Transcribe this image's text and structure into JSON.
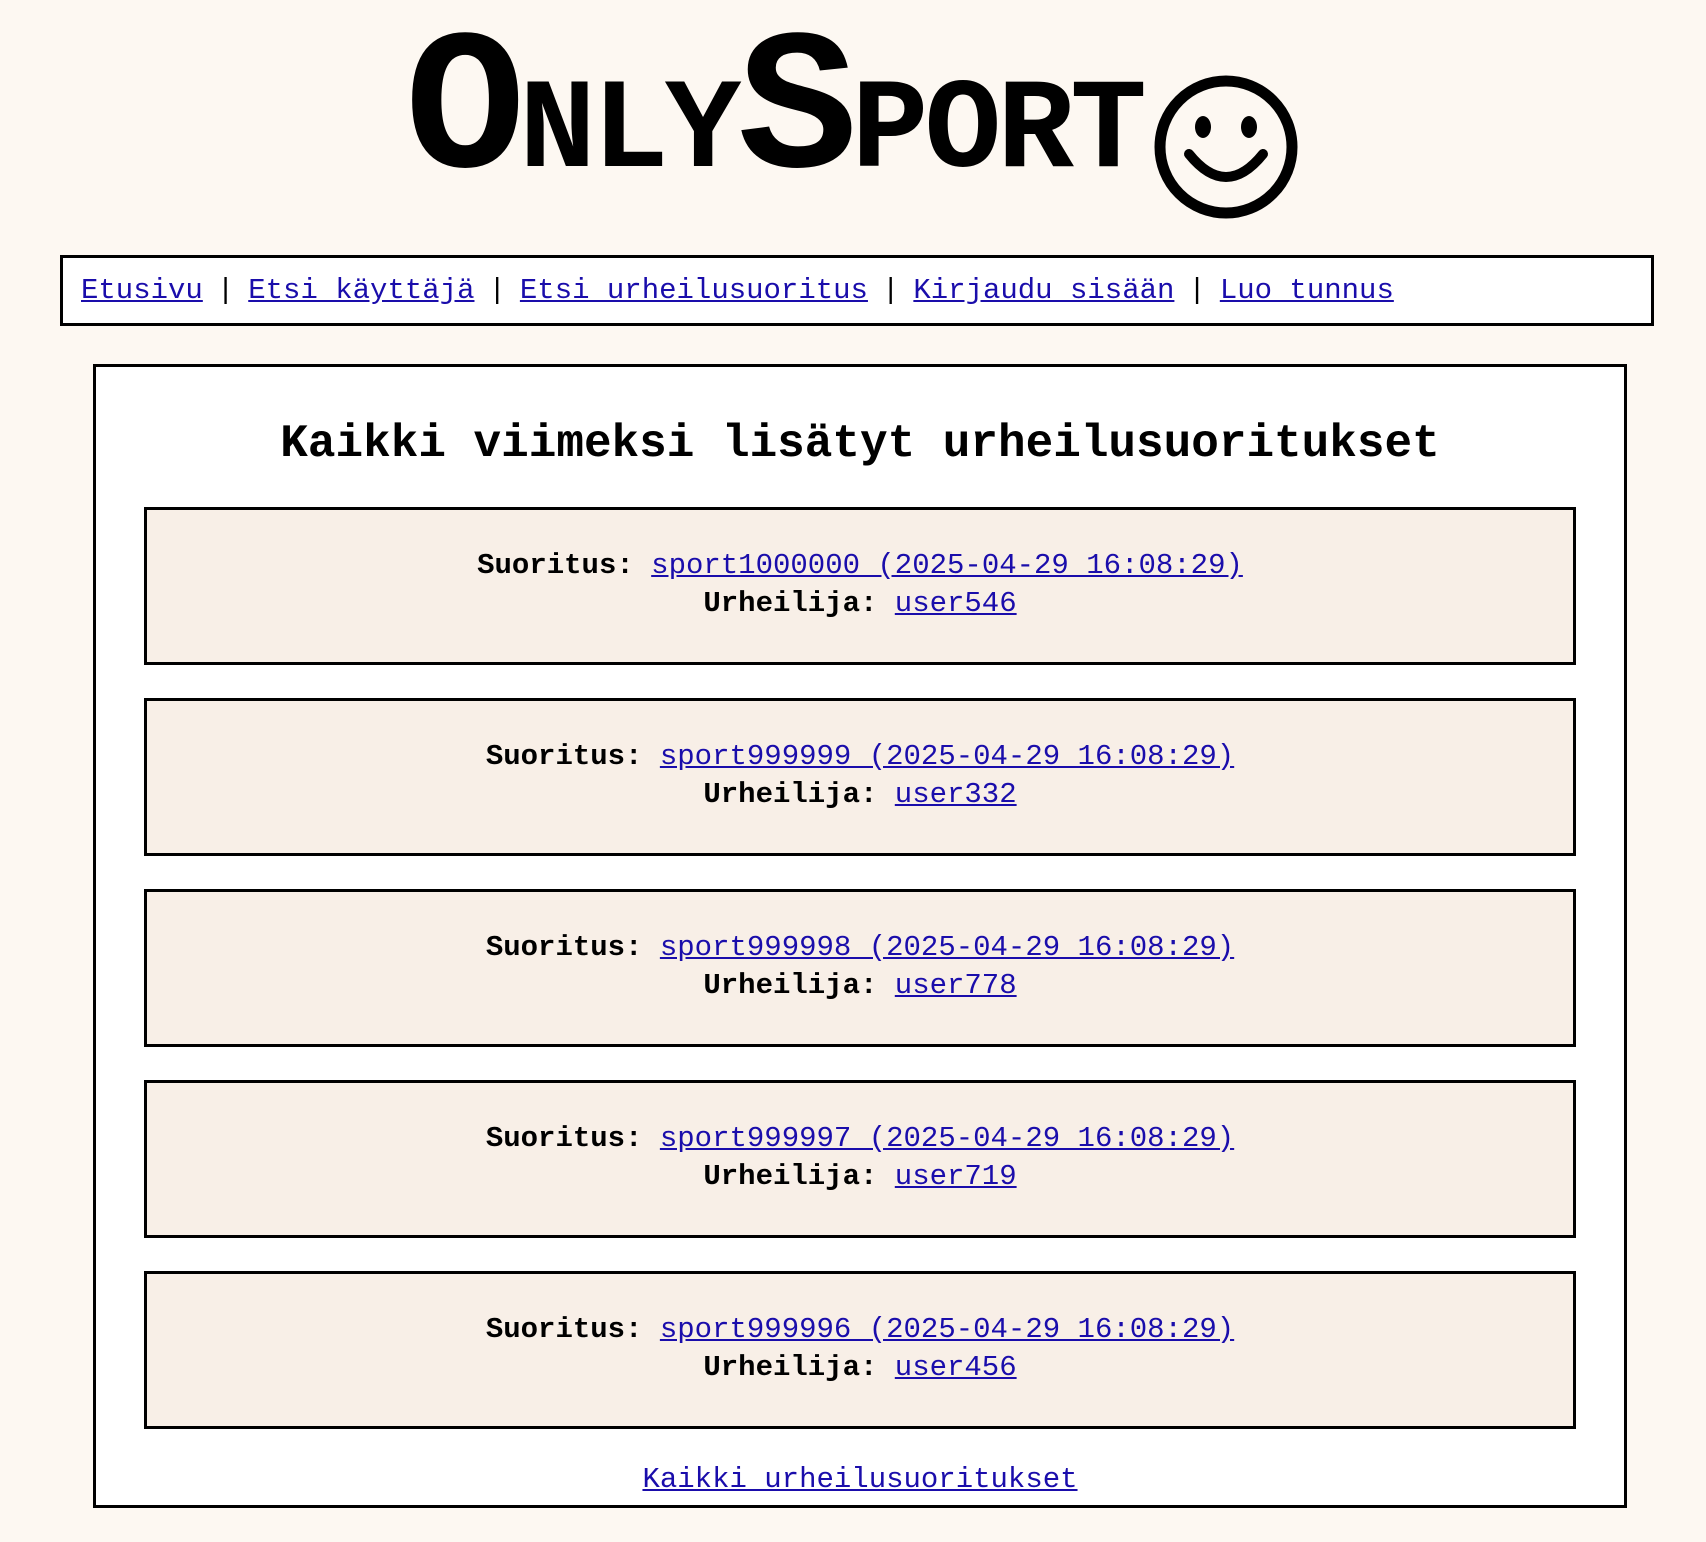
{
  "logo": {
    "part1_cap": "O",
    "part1_rest": "NLY",
    "part2_cap": "S",
    "part2_rest": "PORT",
    "smiley": "☺"
  },
  "nav": {
    "items": [
      {
        "label": "Etusivu"
      },
      {
        "label": "Etsi käyttäjä"
      },
      {
        "label": "Etsi urheilusuoritus"
      },
      {
        "label": "Kirjaudu sisään"
      },
      {
        "label": "Luo tunnus"
      }
    ],
    "separator": "|"
  },
  "main": {
    "title": "Kaikki viimeksi lisätyt urheilusuoritukset",
    "performance_label": "Suoritus:",
    "athlete_label": "Urheilija:",
    "entries": [
      {
        "performance": "sport1000000 (2025-04-29 16:08:29)",
        "athlete": "user546"
      },
      {
        "performance": "sport999999 (2025-04-29 16:08:29)",
        "athlete": "user332"
      },
      {
        "performance": "sport999998 (2025-04-29 16:08:29)",
        "athlete": "user778"
      },
      {
        "performance": "sport999997 (2025-04-29 16:08:29)",
        "athlete": "user719"
      },
      {
        "performance": "sport999996 (2025-04-29 16:08:29)",
        "athlete": "user456"
      }
    ],
    "all_link": "Kaikki urheilusuoritukset"
  }
}
